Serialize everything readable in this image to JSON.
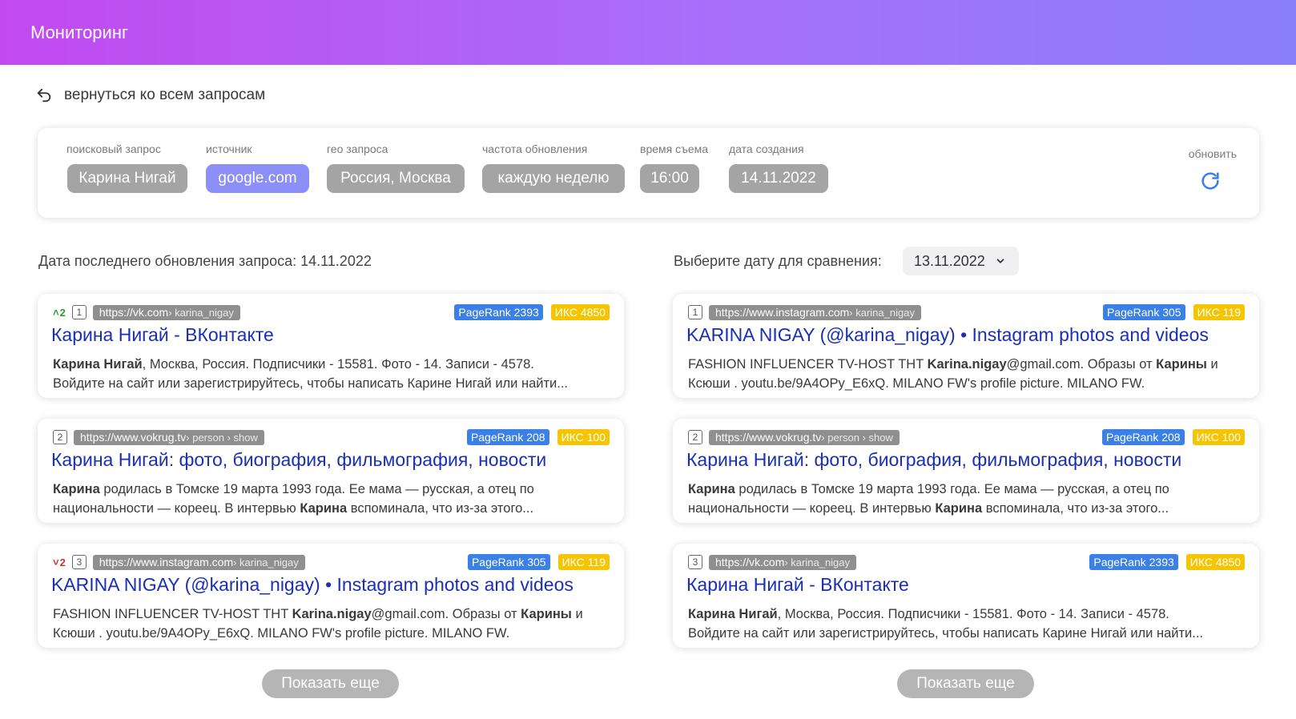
{
  "header": {
    "title": "Мониторинг"
  },
  "back": {
    "label": "вернуться ко всем запросам",
    "icon": "undo-icon"
  },
  "params": {
    "query": {
      "label": "поисковый запрос",
      "value": "Карина Нигай"
    },
    "source": {
      "label": "источник",
      "value": "google.com"
    },
    "geo": {
      "label": "гео запроса",
      "value": "Россия, Москва"
    },
    "frequency": {
      "label": "частота обновления",
      "value": "каждую неделю"
    },
    "time": {
      "label": "время съема",
      "value": "16:00"
    },
    "created": {
      "label": "дата создания",
      "value": "14.11.2022"
    },
    "refresh": {
      "label": "обновить",
      "icon": "refresh-icon"
    }
  },
  "colors": {
    "accent_chip": "#8d8ff8",
    "chip": "#a4a4a4",
    "link": "#1a2fb5",
    "pagerank": "#3a80e8",
    "iks": "#f6c400",
    "up": "#2e9a2e",
    "down": "#d22e2e"
  },
  "left": {
    "heading": "Дата последнего обновления запроса: 14.11.2022",
    "results": [
      {
        "delta": "2",
        "delta_dir": "up",
        "pos": "1",
        "domain": "https://vk.com",
        "path": " › karina_nigay",
        "pagerank": "PageRank 2393",
        "iks": "ИКС 4850",
        "title_bold": "Карина Нигай",
        "title_rest": " - ВКонтакте",
        "line1_bold": "Карина Нигай",
        "line1": ", Москва, Россия. Подписчики - 15581. Фото - 14. Записи - 4578.",
        "line2": "Войдите на сайт или зарегистрируйтесь, чтобы написать Карине Нигай или найти..."
      },
      {
        "delta": "",
        "delta_dir": "",
        "pos": "2",
        "domain": "https://www.vokrug.tv",
        "path": " › person › show",
        "pagerank": "PageRank 208",
        "iks": "ИКС 100",
        "title_bold": "Карина Нигай",
        "title_rest": ": фото, биография, фильмография, новости",
        "line1_bold": "Карина",
        "line1": " родилась в Томске 19 марта 1993 года. Ее мама — русская, а отец по",
        "line2_pre": "национальности — кореец. В интервью ",
        "line2_bold": "Карина",
        "line2": " вспоминала, что из-за этого..."
      },
      {
        "delta": "2",
        "delta_dir": "down",
        "pos": "3",
        "domain": "https://www.instagram.com",
        "path": " › karina_nigay",
        "pagerank": "PageRank 305",
        "iks": "ИКС 119",
        "title_bold": "KARINA NIGAY",
        "title_rest": " (@karina_nigay) • Instagram photos and videos",
        "line1_pre": "FASHION INFLUENCER TV-HOST THT ",
        "line1_bold": "Karina.nigay",
        "line1": "@gmail.com. Образы от ",
        "line1_bold2": "Карины",
        "line1_post": " и",
        "line2": "Ксюши . youtu.be/9A4OPy_E6xQ. MILANO FW's profile picture. MILANO FW."
      }
    ],
    "more": "Показать еще"
  },
  "right": {
    "heading": "Выберите дату для сравнения:",
    "date": "13.11.2022",
    "results": [
      {
        "pos": "1",
        "domain": "https://www.instagram.com",
        "path": " › karina_nigay",
        "pagerank": "PageRank 305",
        "iks": "ИКС 119",
        "title_bold": "KARINA NIGAY",
        "title_rest": " (@karina_nigay) • Instagram photos and videos",
        "line1_pre": "FASHION INFLUENCER TV-HOST THT ",
        "line1_bold": "Karina.nigay",
        "line1": "@gmail.com. Образы от ",
        "line1_bold2": "Карины",
        "line1_post": " и",
        "line2": "Ксюши . youtu.be/9A4OPy_E6xQ. MILANO FW's profile picture. MILANO FW."
      },
      {
        "pos": "2",
        "domain": "https://www.vokrug.tv",
        "path": " › person › show",
        "pagerank": "PageRank 208",
        "iks": "ИКС 100",
        "title_bold": "Карина Нигай",
        "title_rest": ": фото, биография, фильмография, новости",
        "line1_bold": "Карина",
        "line1": " родилась в Томске 19 марта 1993 года. Ее мама — русская, а отец по",
        "line2_pre": "национальности — кореец. В интервью ",
        "line2_bold": "Карина",
        "line2": " вспоминала, что из-за этого..."
      },
      {
        "pos": "3",
        "domain": "https://vk.com",
        "path": " › karina_nigay",
        "pagerank": "PageRank 2393",
        "iks": "ИКС 4850",
        "title_bold": "Карина Нигай",
        "title_rest": " - ВКонтакте",
        "line1_bold": "Карина Нигай",
        "line1": ", Москва, Россия. Подписчики - 15581. Фото - 14. Записи - 4578.",
        "line2": "Войдите на сайт или зарегистрируйтесь, чтобы написать Карине Нигай или найти..."
      }
    ],
    "more": "Показать еще"
  }
}
